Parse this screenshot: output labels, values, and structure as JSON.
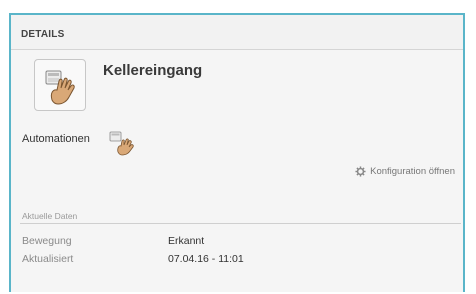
{
  "panel": {
    "title": "DETAILS"
  },
  "device": {
    "name": "Kellereingang",
    "icon": "door-hand-icon"
  },
  "automations": {
    "label": "Automationen",
    "icon": "automation-hand-icon"
  },
  "config": {
    "label": "Konfiguration öffnen",
    "icon": "gear-icon"
  },
  "current_data": {
    "heading": "Aktuelle Daten",
    "rows": [
      {
        "label": "Bewegung",
        "value": "Erkannt"
      },
      {
        "label": "Aktualisiert",
        "value": "07.04.16 - 11:01"
      }
    ]
  },
  "colors": {
    "frame_border": "#5ab5c9",
    "hand": "#d9a877"
  }
}
